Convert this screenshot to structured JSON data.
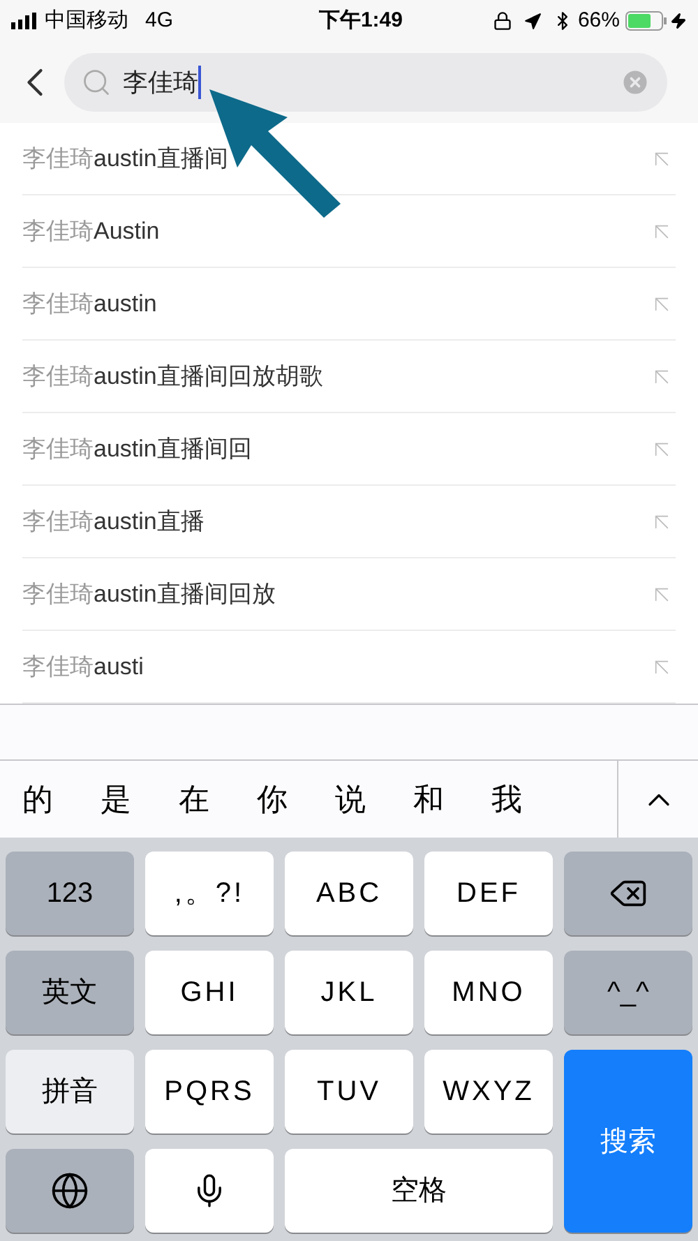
{
  "status_bar": {
    "carrier": "中国移动",
    "network": "4G",
    "time": "下午1:49",
    "battery_text": "66%"
  },
  "search": {
    "value": "李佳琦"
  },
  "suggestions": [
    {
      "prefix": "李佳琦",
      "suffix": "austin直播间"
    },
    {
      "prefix": "李佳琦",
      "suffix": "Austin"
    },
    {
      "prefix": "李佳琦",
      "suffix": "austin"
    },
    {
      "prefix": "李佳琦",
      "suffix": "austin直播间回放胡歌"
    },
    {
      "prefix": "李佳琦",
      "suffix": "austin直播间回"
    },
    {
      "prefix": "李佳琦",
      "suffix": "austin直播"
    },
    {
      "prefix": "李佳琦",
      "suffix": "austin直播间回放"
    },
    {
      "prefix": "李佳琦",
      "suffix": "austi"
    }
  ],
  "candidates": [
    "的",
    "是",
    "在",
    "你",
    "说",
    "和",
    "我"
  ],
  "keys": [
    {
      "kind": "function",
      "label": "123"
    },
    {
      "kind": "letter",
      "label": ",。?!"
    },
    {
      "kind": "letter",
      "label": "ABC"
    },
    {
      "kind": "letter",
      "label": "DEF"
    },
    {
      "kind": "backspace"
    },
    {
      "kind": "function",
      "label": "英文"
    },
    {
      "kind": "letter",
      "label": "GHI"
    },
    {
      "kind": "letter",
      "label": "JKL"
    },
    {
      "kind": "letter",
      "label": "MNO"
    },
    {
      "kind": "function",
      "label": "^_^"
    },
    {
      "kind": "selected",
      "label": "拼音"
    },
    {
      "kind": "letter",
      "label": "PQRS"
    },
    {
      "kind": "letter",
      "label": "TUV"
    },
    {
      "kind": "letter",
      "label": "WXYZ"
    },
    {
      "kind": "action",
      "label": "搜索"
    },
    {
      "kind": "globe"
    },
    {
      "kind": "mic"
    },
    {
      "kind": "space",
      "label": "空格"
    }
  ]
}
